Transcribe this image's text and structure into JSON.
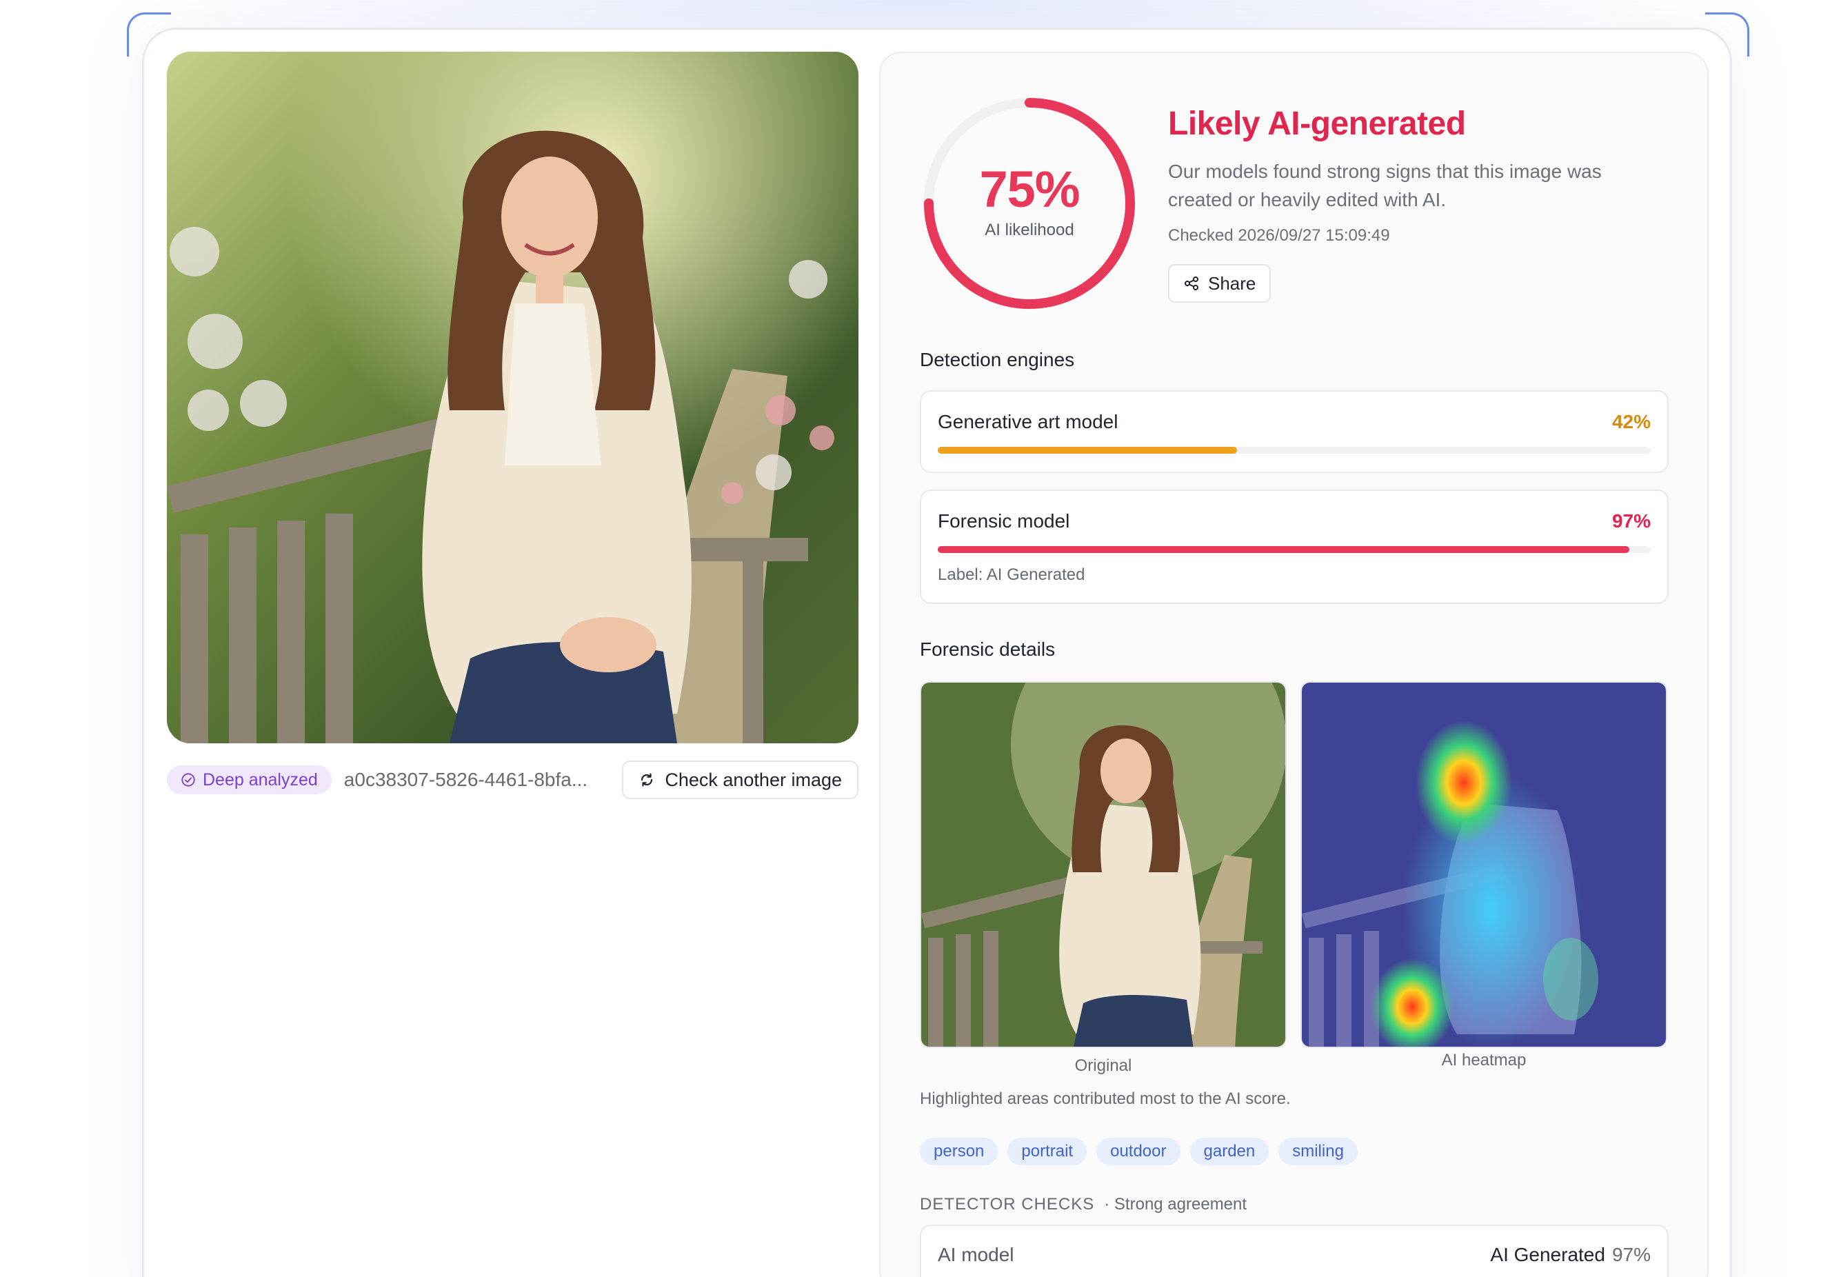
{
  "image": {
    "status_badge": "Deep analyzed",
    "id_text": "a0c38307-5826-4461-8bfa...",
    "check_another_label": "Check another image"
  },
  "result": {
    "score_text": "75%",
    "score_value": 0.75,
    "score_caption": "AI likelihood",
    "verdict": "Likely AI-generated",
    "description": "Our models found strong signs that this image was created or heavily edited with AI.",
    "checked": "Checked 2026/09/27 15:09:49",
    "share_label": "Share",
    "accent_color": "#e7385a"
  },
  "engines": {
    "title": "Detection engines",
    "items": [
      {
        "name": "Generative art model",
        "pct_text": "42%",
        "value": 0.42,
        "color": "#eea21c"
      },
      {
        "name": "Forensic model",
        "pct_text": "97%",
        "value": 0.97,
        "color": "#e7385a",
        "label": "Label: AI Generated"
      }
    ]
  },
  "forensic": {
    "title": "Forensic details",
    "original_caption": "Original",
    "heatmap_caption": "AI heatmap",
    "note": "Highlighted areas contributed most to the AI score."
  },
  "tags": [
    "person",
    "portrait",
    "outdoor",
    "garden",
    "smiling"
  ],
  "checks": {
    "title": "DETECTOR CHECKS",
    "subtitle": "· Strong agreement",
    "rows": [
      {
        "name": "AI model",
        "result": "AI Generated",
        "pct": "97%"
      }
    ]
  }
}
